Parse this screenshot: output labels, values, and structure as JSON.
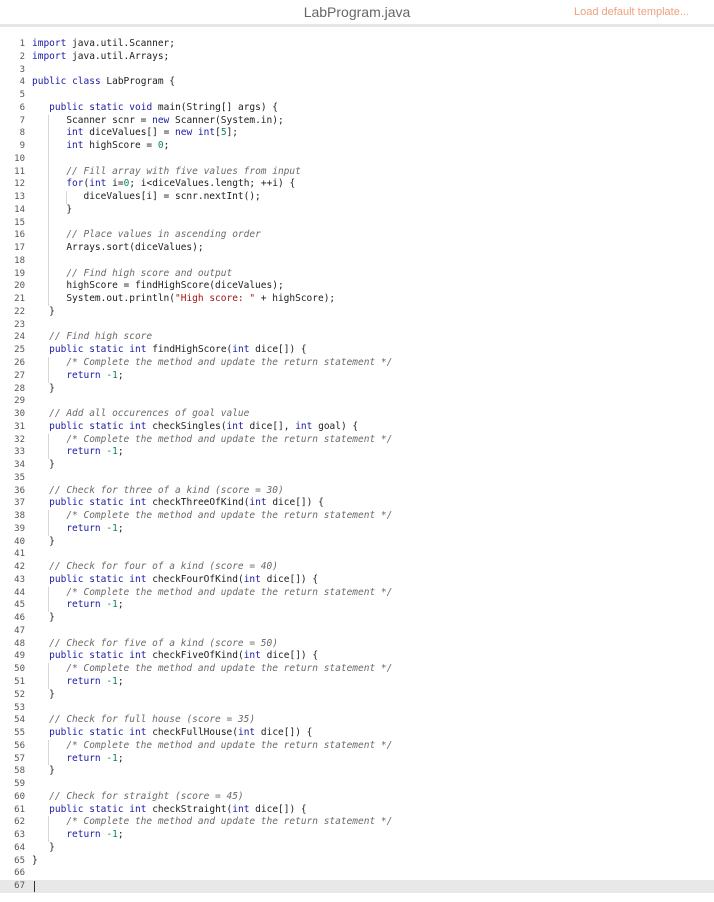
{
  "header": {
    "file_name": "LabProgram.java",
    "load_default_label": "Load default template..."
  },
  "editor": {
    "lines": [
      {
        "n": "1",
        "text": "import java.util.Scanner;"
      },
      {
        "n": "2",
        "text": "import java.util.Arrays;"
      },
      {
        "n": "3",
        "text": ""
      },
      {
        "n": "4",
        "text": "public class LabProgram {"
      },
      {
        "n": "5",
        "text": ""
      },
      {
        "n": "6",
        "text": "   public static void main(String[] args) {"
      },
      {
        "n": "7",
        "text": "      Scanner scnr = new Scanner(System.in);"
      },
      {
        "n": "8",
        "text": "      int diceValues[] = new int[5];"
      },
      {
        "n": "9",
        "text": "      int highScore = 0;"
      },
      {
        "n": "10",
        "text": ""
      },
      {
        "n": "11",
        "text": "      // Fill array with five values from input"
      },
      {
        "n": "12",
        "text": "      for(int i=0; i<diceValues.length; ++i) {"
      },
      {
        "n": "13",
        "text": "         diceValues[i] = scnr.nextInt();"
      },
      {
        "n": "14",
        "text": "      }"
      },
      {
        "n": "15",
        "text": ""
      },
      {
        "n": "16",
        "text": "      // Place values in ascending order"
      },
      {
        "n": "17",
        "text": "      Arrays.sort(diceValues);"
      },
      {
        "n": "18",
        "text": ""
      },
      {
        "n": "19",
        "text": "      // Find high score and output"
      },
      {
        "n": "20",
        "text": "      highScore = findHighScore(diceValues);"
      },
      {
        "n": "21",
        "text": "      System.out.println(\"High score: \" + highScore);"
      },
      {
        "n": "22",
        "text": "   }"
      },
      {
        "n": "23",
        "text": ""
      },
      {
        "n": "24",
        "text": "   // Find high score"
      },
      {
        "n": "25",
        "text": "   public static int findHighScore(int dice[]) {"
      },
      {
        "n": "26",
        "text": "      /* Complete the method and update the return statement */"
      },
      {
        "n": "27",
        "text": "      return -1;"
      },
      {
        "n": "28",
        "text": "   }"
      },
      {
        "n": "29",
        "text": ""
      },
      {
        "n": "30",
        "text": "   // Add all occurences of goal value"
      },
      {
        "n": "31",
        "text": "   public static int checkSingles(int dice[], int goal) {"
      },
      {
        "n": "32",
        "text": "      /* Complete the method and update the return statement */"
      },
      {
        "n": "33",
        "text": "      return -1;"
      },
      {
        "n": "34",
        "text": "   }"
      },
      {
        "n": "35",
        "text": ""
      },
      {
        "n": "36",
        "text": "   // Check for three of a kind (score = 30)"
      },
      {
        "n": "37",
        "text": "   public static int checkThreeOfKind(int dice[]) {"
      },
      {
        "n": "38",
        "text": "      /* Complete the method and update the return statement */"
      },
      {
        "n": "39",
        "text": "      return -1;"
      },
      {
        "n": "40",
        "text": "   }"
      },
      {
        "n": "41",
        "text": ""
      },
      {
        "n": "42",
        "text": "   // Check for four of a kind (score = 40)"
      },
      {
        "n": "43",
        "text": "   public static int checkFourOfKind(int dice[]) {"
      },
      {
        "n": "44",
        "text": "      /* Complete the method and update the return statement */"
      },
      {
        "n": "45",
        "text": "      return -1;"
      },
      {
        "n": "46",
        "text": "   }"
      },
      {
        "n": "47",
        "text": ""
      },
      {
        "n": "48",
        "text": "   // Check for five of a kind (score = 50)"
      },
      {
        "n": "49",
        "text": "   public static int checkFiveOfKind(int dice[]) {"
      },
      {
        "n": "50",
        "text": "      /* Complete the method and update the return statement */"
      },
      {
        "n": "51",
        "text": "      return -1;"
      },
      {
        "n": "52",
        "text": "   }"
      },
      {
        "n": "53",
        "text": ""
      },
      {
        "n": "54",
        "text": "   // Check for full house (score = 35)"
      },
      {
        "n": "55",
        "text": "   public static int checkFullHouse(int dice[]) {"
      },
      {
        "n": "56",
        "text": "      /* Complete the method and update the return statement */"
      },
      {
        "n": "57",
        "text": "      return -1;"
      },
      {
        "n": "58",
        "text": "   }"
      },
      {
        "n": "59",
        "text": ""
      },
      {
        "n": "60",
        "text": "   // Check for straight (score = 45)"
      },
      {
        "n": "61",
        "text": "   public static int checkStraight(int dice[]) {"
      },
      {
        "n": "62",
        "text": "      /* Complete the method and update the return statement */"
      },
      {
        "n": "63",
        "text": "      return -1;"
      },
      {
        "n": "64",
        "text": "   }"
      },
      {
        "n": "65",
        "text": "}"
      },
      {
        "n": "66",
        "text": ""
      },
      {
        "n": "67",
        "text": ""
      }
    ]
  }
}
